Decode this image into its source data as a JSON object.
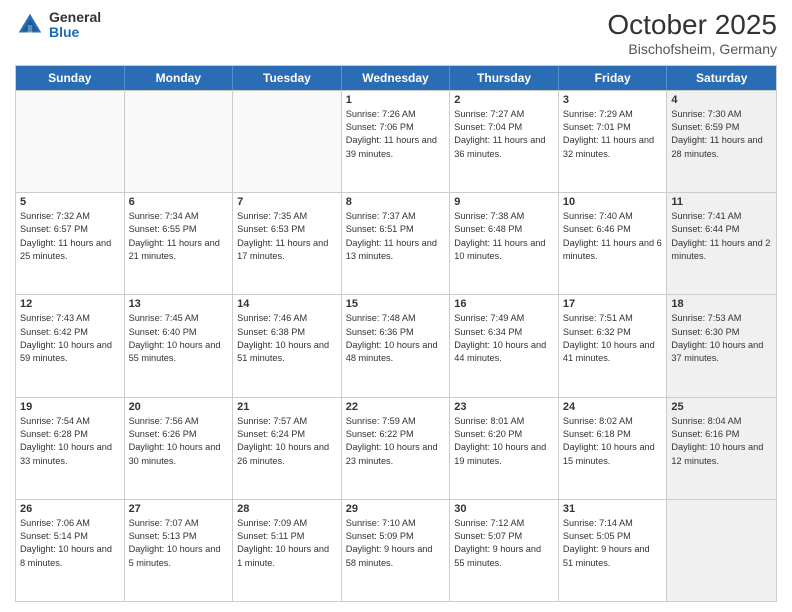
{
  "header": {
    "logo_general": "General",
    "logo_blue": "Blue",
    "title": "October 2025",
    "subtitle": "Bischofsheim, Germany"
  },
  "days_of_week": [
    "Sunday",
    "Monday",
    "Tuesday",
    "Wednesday",
    "Thursday",
    "Friday",
    "Saturday"
  ],
  "weeks": [
    [
      {
        "day": "",
        "empty": true
      },
      {
        "day": "",
        "empty": true
      },
      {
        "day": "",
        "empty": true
      },
      {
        "day": "1",
        "info": "Sunrise: 7:26 AM\nSunset: 7:06 PM\nDaylight: 11 hours and 39 minutes."
      },
      {
        "day": "2",
        "info": "Sunrise: 7:27 AM\nSunset: 7:04 PM\nDaylight: 11 hours and 36 minutes."
      },
      {
        "day": "3",
        "info": "Sunrise: 7:29 AM\nSunset: 7:01 PM\nDaylight: 11 hours and 32 minutes."
      },
      {
        "day": "4",
        "info": "Sunrise: 7:30 AM\nSunset: 6:59 PM\nDaylight: 11 hours and 28 minutes.",
        "shaded": true
      }
    ],
    [
      {
        "day": "5",
        "info": "Sunrise: 7:32 AM\nSunset: 6:57 PM\nDaylight: 11 hours and 25 minutes."
      },
      {
        "day": "6",
        "info": "Sunrise: 7:34 AM\nSunset: 6:55 PM\nDaylight: 11 hours and 21 minutes."
      },
      {
        "day": "7",
        "info": "Sunrise: 7:35 AM\nSunset: 6:53 PM\nDaylight: 11 hours and 17 minutes."
      },
      {
        "day": "8",
        "info": "Sunrise: 7:37 AM\nSunset: 6:51 PM\nDaylight: 11 hours and 13 minutes."
      },
      {
        "day": "9",
        "info": "Sunrise: 7:38 AM\nSunset: 6:48 PM\nDaylight: 11 hours and 10 minutes."
      },
      {
        "day": "10",
        "info": "Sunrise: 7:40 AM\nSunset: 6:46 PM\nDaylight: 11 hours and 6 minutes."
      },
      {
        "day": "11",
        "info": "Sunrise: 7:41 AM\nSunset: 6:44 PM\nDaylight: 11 hours and 2 minutes.",
        "shaded": true
      }
    ],
    [
      {
        "day": "12",
        "info": "Sunrise: 7:43 AM\nSunset: 6:42 PM\nDaylight: 10 hours and 59 minutes."
      },
      {
        "day": "13",
        "info": "Sunrise: 7:45 AM\nSunset: 6:40 PM\nDaylight: 10 hours and 55 minutes."
      },
      {
        "day": "14",
        "info": "Sunrise: 7:46 AM\nSunset: 6:38 PM\nDaylight: 10 hours and 51 minutes."
      },
      {
        "day": "15",
        "info": "Sunrise: 7:48 AM\nSunset: 6:36 PM\nDaylight: 10 hours and 48 minutes."
      },
      {
        "day": "16",
        "info": "Sunrise: 7:49 AM\nSunset: 6:34 PM\nDaylight: 10 hours and 44 minutes."
      },
      {
        "day": "17",
        "info": "Sunrise: 7:51 AM\nSunset: 6:32 PM\nDaylight: 10 hours and 41 minutes."
      },
      {
        "day": "18",
        "info": "Sunrise: 7:53 AM\nSunset: 6:30 PM\nDaylight: 10 hours and 37 minutes.",
        "shaded": true
      }
    ],
    [
      {
        "day": "19",
        "info": "Sunrise: 7:54 AM\nSunset: 6:28 PM\nDaylight: 10 hours and 33 minutes."
      },
      {
        "day": "20",
        "info": "Sunrise: 7:56 AM\nSunset: 6:26 PM\nDaylight: 10 hours and 30 minutes."
      },
      {
        "day": "21",
        "info": "Sunrise: 7:57 AM\nSunset: 6:24 PM\nDaylight: 10 hours and 26 minutes."
      },
      {
        "day": "22",
        "info": "Sunrise: 7:59 AM\nSunset: 6:22 PM\nDaylight: 10 hours and 23 minutes."
      },
      {
        "day": "23",
        "info": "Sunrise: 8:01 AM\nSunset: 6:20 PM\nDaylight: 10 hours and 19 minutes."
      },
      {
        "day": "24",
        "info": "Sunrise: 8:02 AM\nSunset: 6:18 PM\nDaylight: 10 hours and 15 minutes."
      },
      {
        "day": "25",
        "info": "Sunrise: 8:04 AM\nSunset: 6:16 PM\nDaylight: 10 hours and 12 minutes.",
        "shaded": true
      }
    ],
    [
      {
        "day": "26",
        "info": "Sunrise: 7:06 AM\nSunset: 5:14 PM\nDaylight: 10 hours and 8 minutes."
      },
      {
        "day": "27",
        "info": "Sunrise: 7:07 AM\nSunset: 5:13 PM\nDaylight: 10 hours and 5 minutes."
      },
      {
        "day": "28",
        "info": "Sunrise: 7:09 AM\nSunset: 5:11 PM\nDaylight: 10 hours and 1 minute."
      },
      {
        "day": "29",
        "info": "Sunrise: 7:10 AM\nSunset: 5:09 PM\nDaylight: 9 hours and 58 minutes."
      },
      {
        "day": "30",
        "info": "Sunrise: 7:12 AM\nSunset: 5:07 PM\nDaylight: 9 hours and 55 minutes."
      },
      {
        "day": "31",
        "info": "Sunrise: 7:14 AM\nSunset: 5:05 PM\nDaylight: 9 hours and 51 minutes."
      },
      {
        "day": "",
        "empty": true,
        "shaded": true
      }
    ]
  ]
}
